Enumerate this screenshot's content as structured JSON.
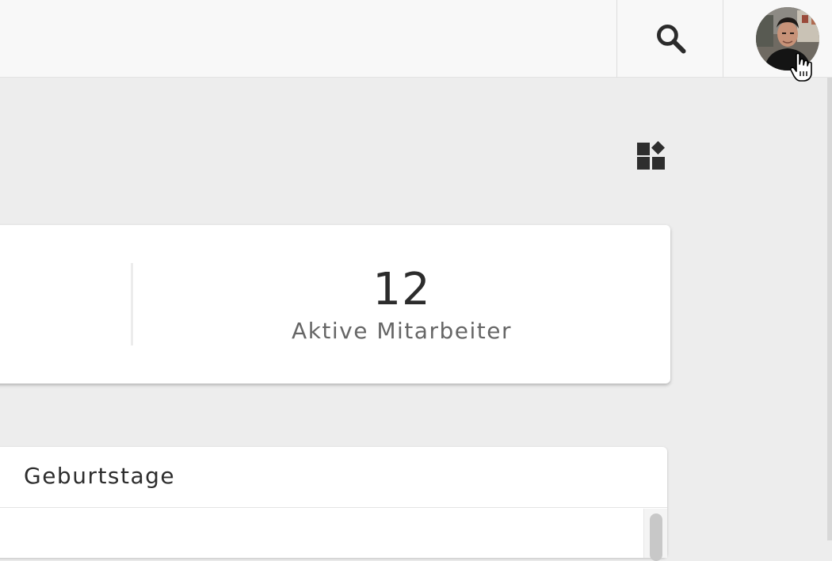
{
  "header": {
    "search_icon": "search-icon",
    "avatar_icon": "user-avatar"
  },
  "toolbar": {
    "widgets_icon": "widgets-icon"
  },
  "stats": {
    "active_employees_value": "12",
    "active_employees_label": "Aktive Mitarbeiter"
  },
  "birthdays": {
    "title": "Geburtstage"
  },
  "colors": {
    "topbar_bg": "#f8f8f8",
    "page_bg": "#ededed",
    "card_bg": "#ffffff",
    "text_primary": "#2c2c2c",
    "text_secondary": "#666666"
  }
}
